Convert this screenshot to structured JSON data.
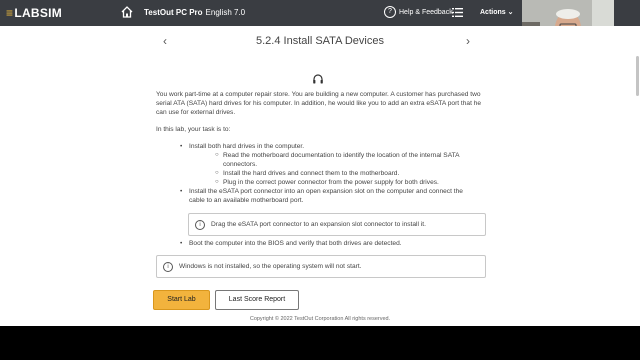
{
  "header": {
    "logo_mark": "≡",
    "logo_text": "LABSIM",
    "course_title": "TestOut PC Pro",
    "course_language": "English 7.0",
    "help_label": "Help & Feedback",
    "actions_label": "Actions"
  },
  "lesson": {
    "title": "5.2.4 Install SATA Devices",
    "intro": "You work part-time at a computer repair store. You are building a new computer. A customer has purchased two serial ATA (SATA) hard drives for his computer. In addition, he would like you to add an extra eSATA port that he can use for external drives.",
    "task_lead": "In this lab, your task is to:",
    "tasks": [
      "Install both hard drives in the computer.",
      "Install the eSATA port connector into an open expansion slot on the computer and connect the cable to an available motherboard port.",
      "Boot the computer into the BIOS and verify that both drives are detected."
    ],
    "subtasks": [
      "Read the motherboard documentation to identify the location of the internal SATA connectors.",
      "Install the hard drives and connect them to the motherboard.",
      "Plug in the correct power connector from the power supply for both drives."
    ],
    "tip": "Drag the eSATA port connector to an expansion slot connector to install it.",
    "notice": "Windows is not installed, so the operating system will not start."
  },
  "buttons": {
    "start": "Start Lab",
    "last_score": "Last Score Report"
  },
  "footer": {
    "copyright": "Copyright © 2022 TestOut Corporation  All rights reserved."
  },
  "colors": {
    "topbar": "#3a3d42",
    "accent": "#f2b33d",
    "logo_mark": "#e8b63c"
  }
}
